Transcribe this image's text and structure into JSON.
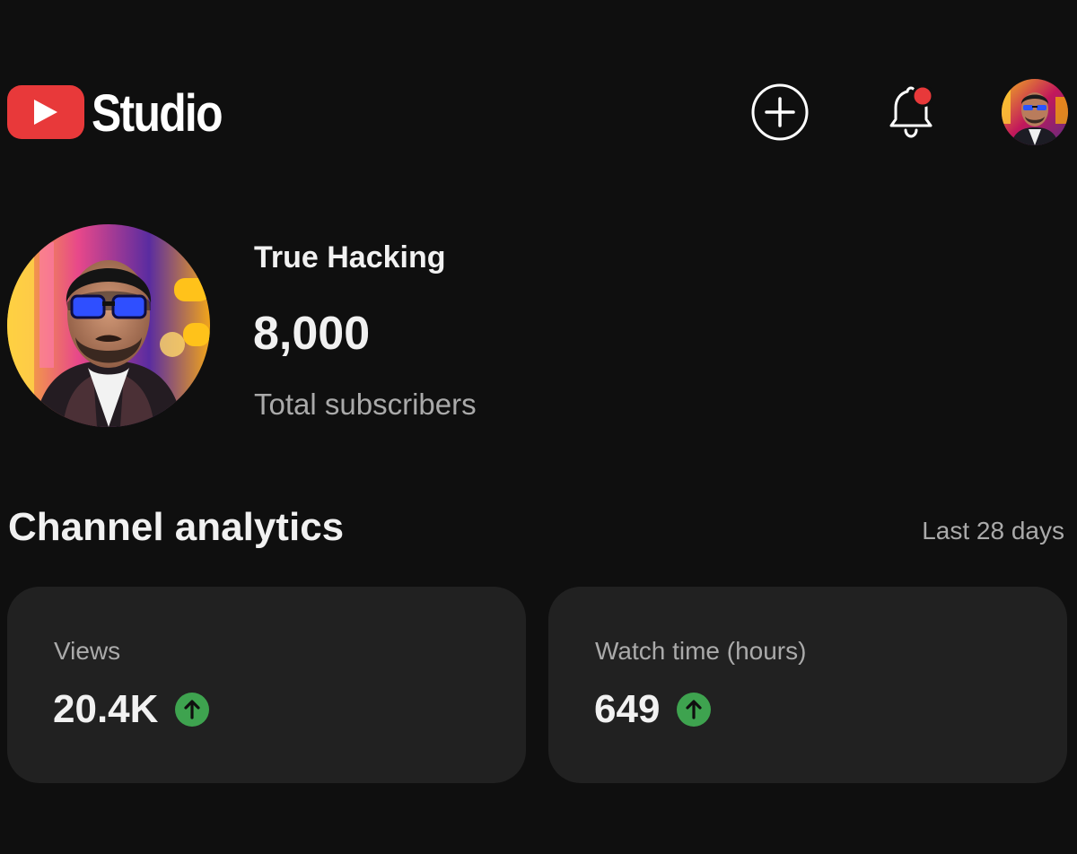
{
  "header": {
    "logo_text": "Studio",
    "icons": {
      "logo": "youtube-play-icon",
      "create": "plus-circle-icon",
      "notifications": "bell-icon",
      "account": "avatar"
    },
    "notification_dot_color": "#e8393a"
  },
  "channel": {
    "name": "True Hacking",
    "subscribers": "8,000",
    "subscribers_label": "Total subscribers"
  },
  "analytics": {
    "title": "Channel analytics",
    "period": "Last 28 days",
    "cards": [
      {
        "label": "Views",
        "value": "20.4K",
        "trend": "up",
        "trend_icon": "arrow-up-icon"
      },
      {
        "label": "Watch time (hours)",
        "value": "649",
        "trend": "up",
        "trend_icon": "arrow-up-icon"
      }
    ]
  },
  "colors": {
    "background": "#0f0f0f",
    "card": "#212121",
    "brand_red": "#e8393a",
    "trend_up": "#3ea34f",
    "secondary_text": "#aaaaaa"
  }
}
